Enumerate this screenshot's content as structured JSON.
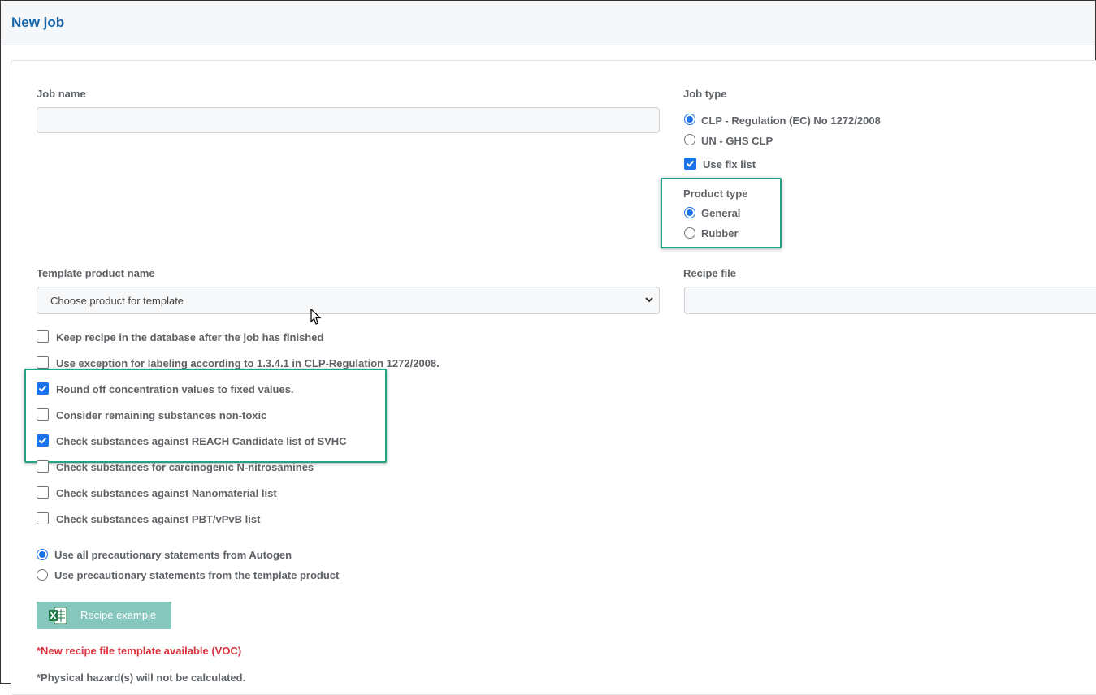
{
  "header": {
    "title": "New job"
  },
  "form": {
    "job_name": {
      "label": "Job name",
      "value": "",
      "placeholder": ""
    },
    "job_type": {
      "label": "Job type",
      "options": [
        {
          "label": "CLP - Regulation (EC) No 1272/2008",
          "selected": true
        },
        {
          "label": "UN - GHS CLP",
          "selected": false
        }
      ],
      "use_fix_list": {
        "label": "Use fix list",
        "checked": true
      }
    },
    "product_type": {
      "label": "Product type",
      "options": [
        {
          "label": "General",
          "selected": true
        },
        {
          "label": "Rubber",
          "selected": false
        }
      ]
    },
    "template_product": {
      "label": "Template product name",
      "selected": "Choose product for template"
    },
    "recipe_file": {
      "label": "Recipe file",
      "value": ""
    },
    "checkboxes": [
      {
        "label": "Keep recipe in the database after the job has finished",
        "checked": false
      },
      {
        "label": "Use exception for labeling according to 1.3.4.1 in CLP-Regulation 1272/2008.",
        "checked": false
      },
      {
        "label": "Round off concentration values to fixed values.",
        "checked": true
      },
      {
        "label": "Consider remaining substances non-toxic",
        "checked": false
      },
      {
        "label": "Check substances against REACH Candidate list of SVHC",
        "checked": true
      },
      {
        "label": "Check substances for carcinogenic N-nitrosamines",
        "checked": false
      },
      {
        "label": "Check substances against Nanomaterial list",
        "checked": false
      },
      {
        "label": "Check substances against PBT/vPvB list",
        "checked": false
      }
    ],
    "precautionary": [
      {
        "label": "Use all precautionary statements from Autogen",
        "selected": true
      },
      {
        "label": "Use precautionary statements from the template product",
        "selected": false
      }
    ],
    "recipe_example_button": "Recipe example",
    "notes": {
      "voc": "*New recipe file template available (VOC)",
      "physical": "*Physical hazard(s) will not be calculated."
    }
  },
  "colors": {
    "title": "#1565a9",
    "accent": "#1a73e8",
    "highlight": "#22a383",
    "button": "#86c7bd",
    "warning": "#d9333f"
  },
  "icons": [
    "excel-icon",
    "chevron-down-icon",
    "checkmark-icon",
    "mouse-pointer-icon"
  ]
}
